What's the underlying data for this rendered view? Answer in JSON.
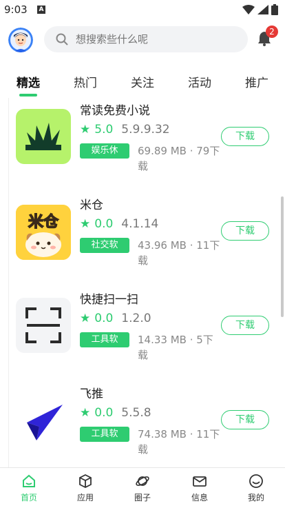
{
  "status_bar": {
    "time": "9:03",
    "notification_letter": "A"
  },
  "header": {
    "search_placeholder": "想搜索些什么呢",
    "notification_count": "2"
  },
  "tabs": [
    {
      "label": "精选",
      "active": true
    },
    {
      "label": "热门"
    },
    {
      "label": "关注"
    },
    {
      "label": "活动"
    },
    {
      "label": "推广"
    }
  ],
  "apps": [
    {
      "name": "常读免费小说",
      "score": "5.0",
      "version": "5.9.9.32",
      "tag": "娱乐休",
      "meta": "69.89 MB · 79下载",
      "download": "下载"
    },
    {
      "name": "米仓",
      "score": "0.0",
      "version": "4.1.14",
      "tag": "社交软",
      "meta": "43.96 MB · 11下载",
      "download": "下载"
    },
    {
      "name": "快捷扫一扫",
      "score": "0.0",
      "version": "1.2.0",
      "tag": "工具软",
      "meta": "14.33 MB · 5下载",
      "download": "下载"
    },
    {
      "name": "飞推",
      "score": "0.0",
      "version": "5.5.8",
      "tag": "工具软",
      "meta": "74.38 MB · 11下载",
      "download": "下载"
    }
  ],
  "bottom_nav": [
    {
      "label": "首页",
      "icon": "home-icon",
      "active": true
    },
    {
      "label": "应用",
      "icon": "cube-icon"
    },
    {
      "label": "圈子",
      "icon": "planet-icon"
    },
    {
      "label": "信息",
      "icon": "mail-icon"
    },
    {
      "label": "我的",
      "icon": "smile-icon"
    }
  ],
  "colors": {
    "accent": "#2ecc71",
    "badge": "#e53935"
  }
}
